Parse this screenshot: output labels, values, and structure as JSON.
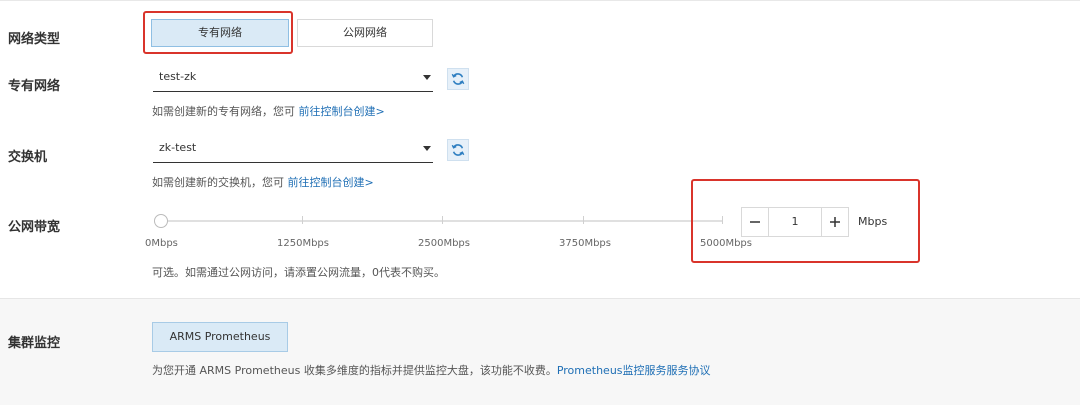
{
  "network_type": {
    "label": "网络类型",
    "options": [
      "专有网络",
      "公网网络"
    ],
    "selected": "专有网络"
  },
  "vpc": {
    "label": "专有网络",
    "value": "test-zk",
    "hint": "如需创建新的专有网络，您可",
    "link": "前往控制台创建>"
  },
  "vswitch": {
    "label": "交换机",
    "value": "zk-test",
    "hint": "如需创建新的交换机，您可",
    "link": "前往控制台创建>"
  },
  "bandwidth": {
    "label": "公网带宽",
    "ticks": [
      "0Mbps",
      "1250Mbps",
      "2500Mbps",
      "3750Mbps",
      "5000Mbps"
    ],
    "value": "1",
    "unit": "Mbps",
    "slider_fraction": 0.0002,
    "hint": "可选。如需通过公网访问，请添置公网流量，0代表不购买。"
  },
  "monitoring": {
    "label": "集群监控",
    "button": "ARMS Prometheus",
    "hint": "为您开通 ARMS Prometheus 收集多维度的指标并提供监控大盘，该功能不收费。",
    "link": "Prometheus监控服务服务协议"
  },
  "icons": {
    "refresh": "refresh-icon",
    "minus": "minus-icon",
    "plus": "plus-icon",
    "caret": "caret-down-icon"
  }
}
